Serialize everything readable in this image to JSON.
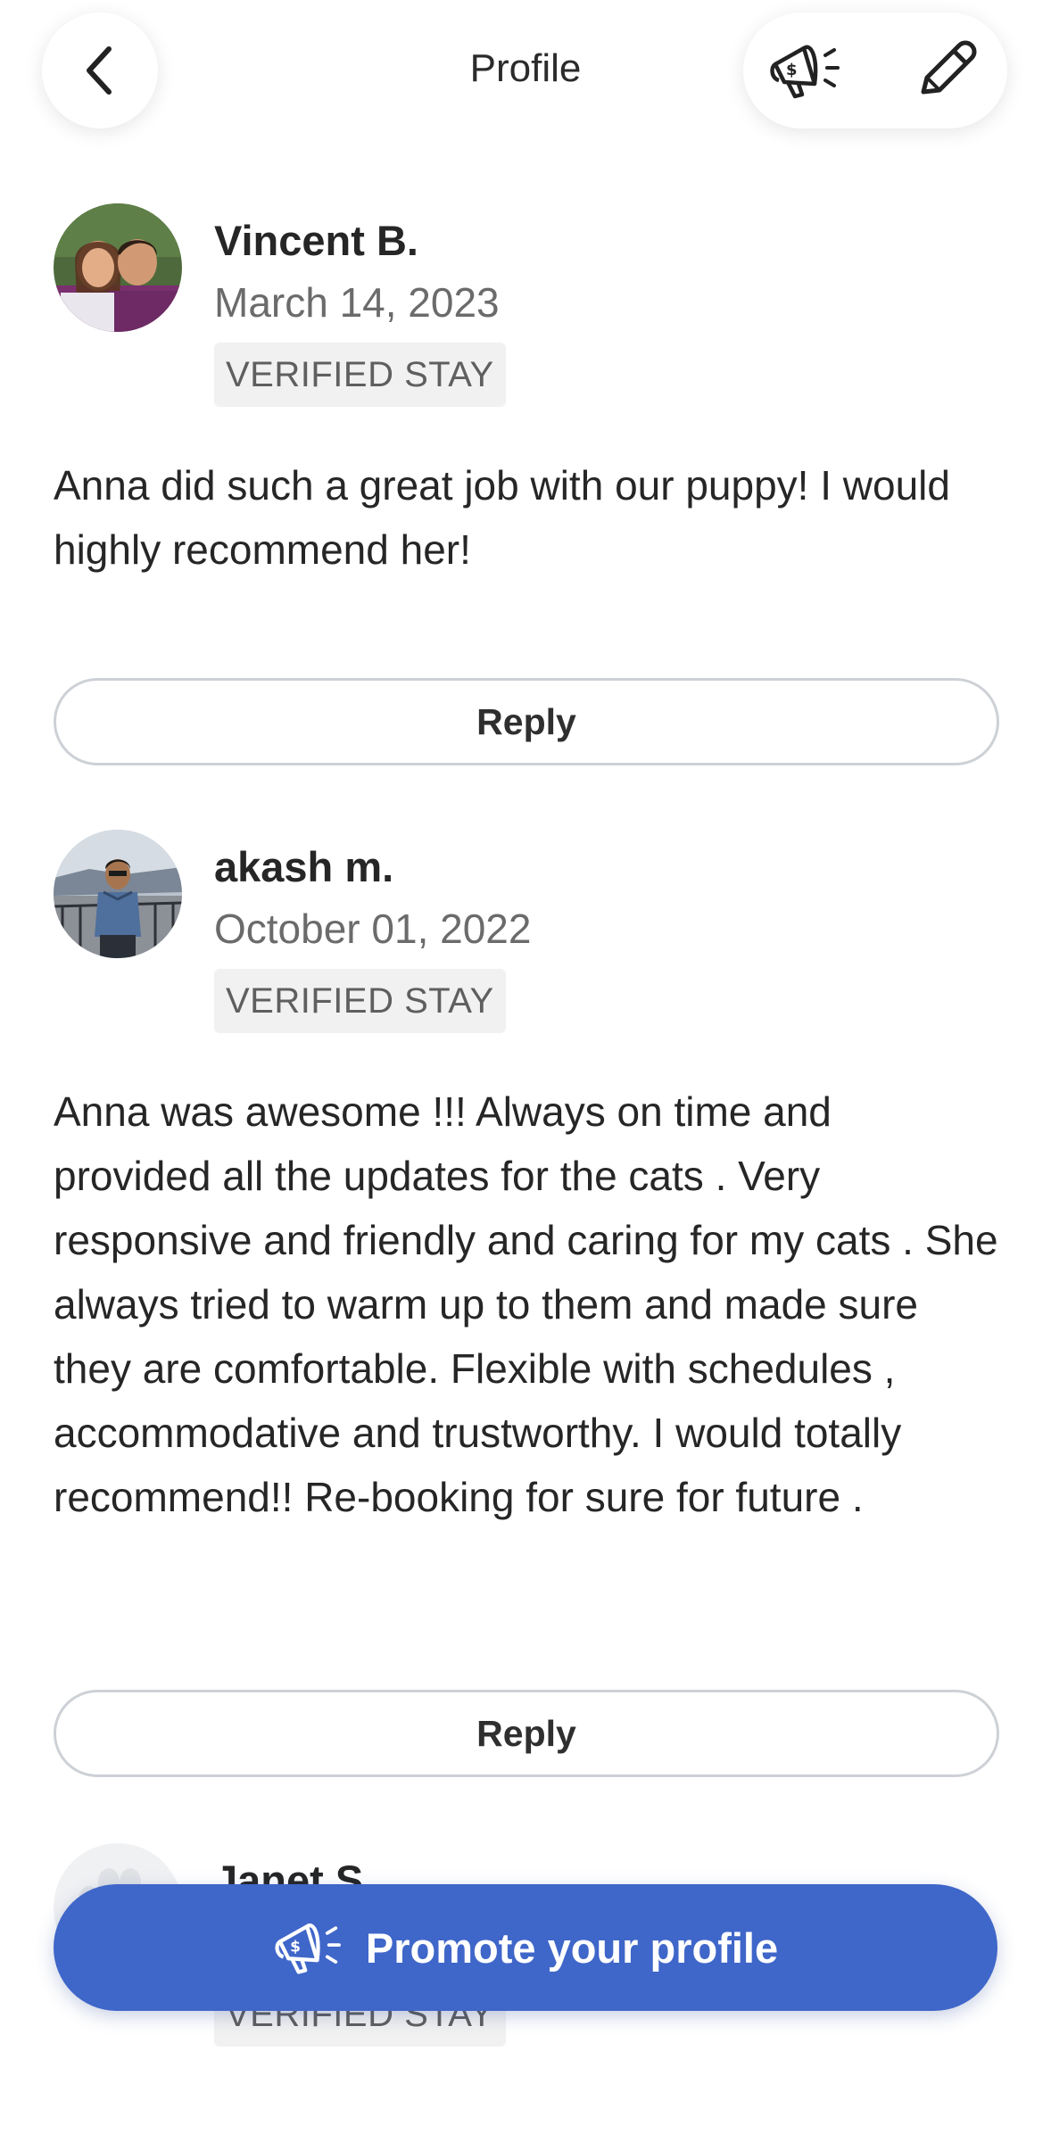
{
  "header": {
    "title": "Profile",
    "back_icon": "chevron-left-icon",
    "promote_icon": "megaphone-dollar-icon",
    "edit_icon": "pencil-icon"
  },
  "reviews": [
    {
      "name": "Vincent B.",
      "date": "March 14, 2023",
      "badge": "VERIFIED STAY",
      "text": "Anna did such a great job with our puppy! I would highly recommend her!",
      "reply_label": "Reply"
    },
    {
      "name": "akash m.",
      "date": "October 01, 2022",
      "badge": "VERIFIED STAY",
      "text": "Anna was awesome !!! Always on time and provided all the updates for the cats . Very responsive and friendly and caring for my cats . She always tried to warm up to them and made sure they are comfortable. Flexible with schedules , accommodative and trustworthy. I would totally recommend!! Re-booking for sure for future .",
      "reply_label": "Reply"
    },
    {
      "name": "Janet S.",
      "badge": "VERIFIED STAY"
    }
  ],
  "promote": {
    "label": "Promote your profile",
    "icon": "megaphone-dollar-icon"
  },
  "colors": {
    "primary": "#3f66c9",
    "badge_bg": "#f1f1f1",
    "muted_text": "#6b6b6b"
  }
}
